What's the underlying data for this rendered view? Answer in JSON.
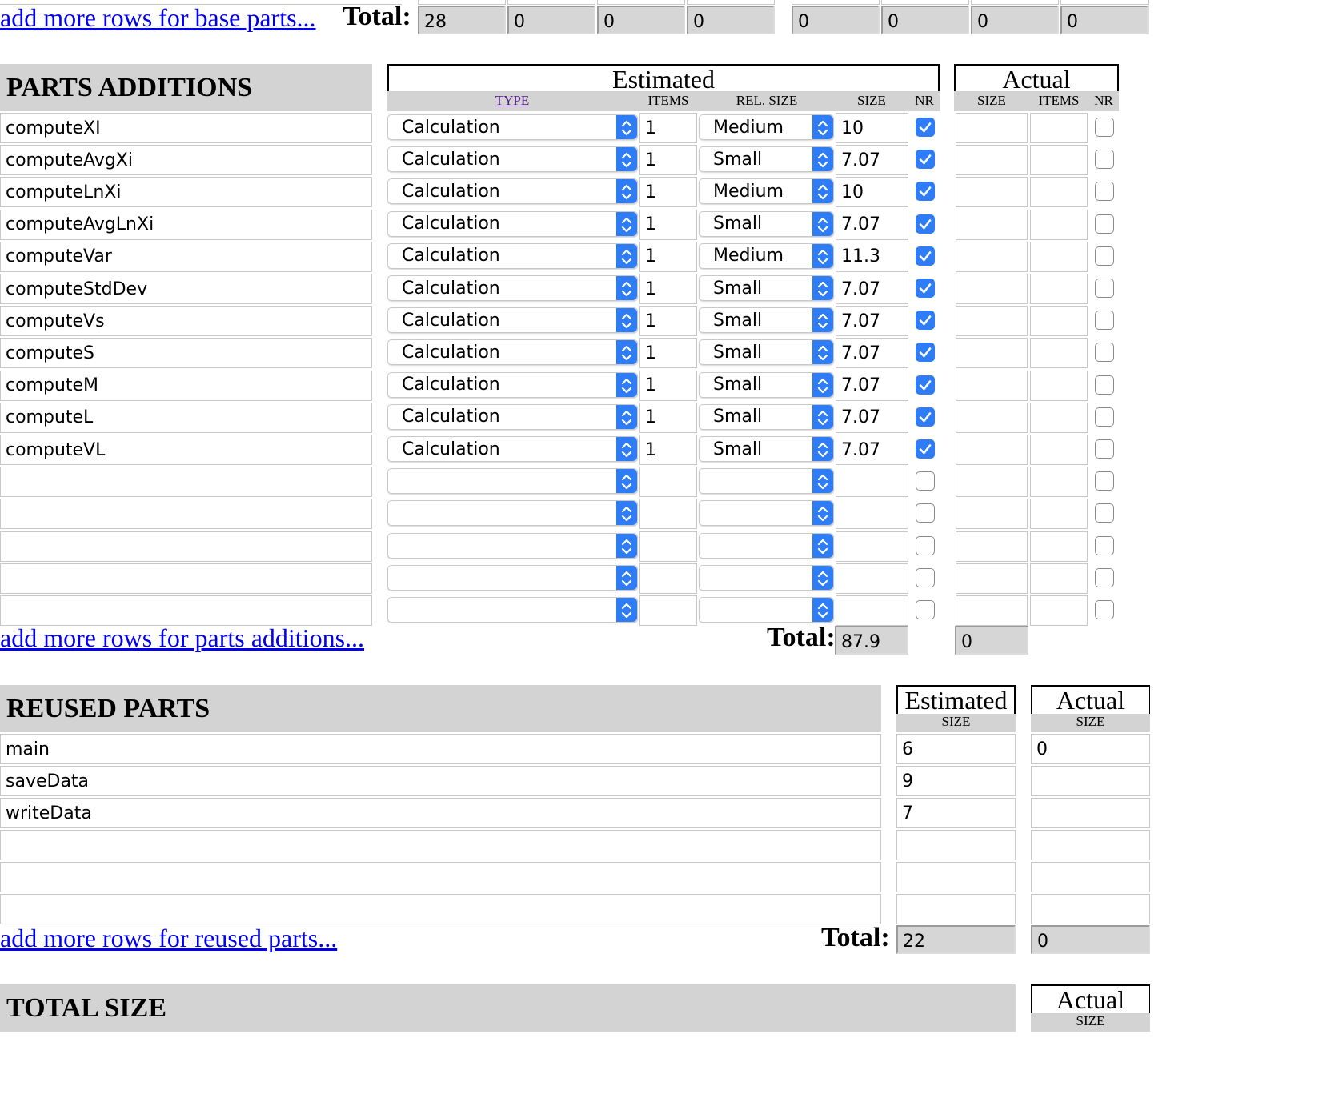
{
  "base_parts": {
    "add_more_link": "add more rows for base parts...",
    "total_label": "Total:",
    "estimated_totals": [
      "28",
      "0",
      "0",
      "0"
    ],
    "actual_totals": [
      "0",
      "0",
      "0",
      "0"
    ]
  },
  "parts_additions": {
    "title": "PARTS ADDITIONS",
    "estimated_header": "Estimated",
    "actual_header": "Actual",
    "columns": {
      "type": "TYPE",
      "items": "ITEMS",
      "rel_size": "REL. SIZE",
      "size": "SIZE",
      "nr": "NR",
      "actual_size": "SIZE",
      "actual_items": "ITEMS",
      "actual_nr": "NR"
    },
    "rows": [
      {
        "name": "computeXI",
        "type": "Calculation",
        "items": "1",
        "rel_size": "Medium",
        "size": "10",
        "nr": true,
        "actual_size": "",
        "actual_items": "",
        "actual_nr": false
      },
      {
        "name": "computeAvgXi",
        "type": "Calculation",
        "items": "1",
        "rel_size": "Small",
        "size": "7.07",
        "nr": true,
        "actual_size": "",
        "actual_items": "",
        "actual_nr": false
      },
      {
        "name": "computeLnXi",
        "type": "Calculation",
        "items": "1",
        "rel_size": "Medium",
        "size": "10",
        "nr": true,
        "actual_size": "",
        "actual_items": "",
        "actual_nr": false
      },
      {
        "name": "computeAvgLnXi",
        "type": "Calculation",
        "items": "1",
        "rel_size": "Small",
        "size": "7.07",
        "nr": true,
        "actual_size": "",
        "actual_items": "",
        "actual_nr": false
      },
      {
        "name": "computeVar",
        "type": "Calculation",
        "items": "1",
        "rel_size": "Medium",
        "size": "11.3",
        "nr": true,
        "actual_size": "",
        "actual_items": "",
        "actual_nr": false
      },
      {
        "name": "computeStdDev",
        "type": "Calculation",
        "items": "1",
        "rel_size": "Small",
        "size": "7.07",
        "nr": true,
        "actual_size": "",
        "actual_items": "",
        "actual_nr": false
      },
      {
        "name": "computeVs",
        "type": "Calculation",
        "items": "1",
        "rel_size": "Small",
        "size": "7.07",
        "nr": true,
        "actual_size": "",
        "actual_items": "",
        "actual_nr": false
      },
      {
        "name": "computeS",
        "type": "Calculation",
        "items": "1",
        "rel_size": "Small",
        "size": "7.07",
        "nr": true,
        "actual_size": "",
        "actual_items": "",
        "actual_nr": false
      },
      {
        "name": "computeM",
        "type": "Calculation",
        "items": "1",
        "rel_size": "Small",
        "size": "7.07",
        "nr": true,
        "actual_size": "",
        "actual_items": "",
        "actual_nr": false
      },
      {
        "name": "computeL",
        "type": "Calculation",
        "items": "1",
        "rel_size": "Small",
        "size": "7.07",
        "nr": true,
        "actual_size": "",
        "actual_items": "",
        "actual_nr": false
      },
      {
        "name": "computeVL",
        "type": "Calculation",
        "items": "1",
        "rel_size": "Small",
        "size": "7.07",
        "nr": true,
        "actual_size": "",
        "actual_items": "",
        "actual_nr": false
      },
      {
        "name": "",
        "type": "",
        "items": "",
        "rel_size": "",
        "size": "",
        "nr": false,
        "actual_size": "",
        "actual_items": "",
        "actual_nr": false
      },
      {
        "name": "",
        "type": "",
        "items": "",
        "rel_size": "",
        "size": "",
        "nr": false,
        "actual_size": "",
        "actual_items": "",
        "actual_nr": false
      },
      {
        "name": "",
        "type": "",
        "items": "",
        "rel_size": "",
        "size": "",
        "nr": false,
        "actual_size": "",
        "actual_items": "",
        "actual_nr": false
      },
      {
        "name": "",
        "type": "",
        "items": "",
        "rel_size": "",
        "size": "",
        "nr": false,
        "actual_size": "",
        "actual_items": "",
        "actual_nr": false
      },
      {
        "name": "",
        "type": "",
        "items": "",
        "rel_size": "",
        "size": "",
        "nr": false,
        "actual_size": "",
        "actual_items": "",
        "actual_nr": false
      }
    ],
    "add_more_link": "add more rows for parts additions...",
    "total_label": "Total:",
    "estimated_total": "87.9",
    "actual_total": "0"
  },
  "reused_parts": {
    "title": "REUSED PARTS",
    "estimated_header": "Estimated",
    "actual_header": "Actual",
    "size_label": "SIZE",
    "rows": [
      {
        "name": "main",
        "estimated": "6",
        "actual": "0"
      },
      {
        "name": "saveData",
        "estimated": "9",
        "actual": ""
      },
      {
        "name": "writeData",
        "estimated": "7",
        "actual": ""
      },
      {
        "name": "",
        "estimated": "",
        "actual": ""
      },
      {
        "name": "",
        "estimated": "",
        "actual": ""
      },
      {
        "name": "",
        "estimated": "",
        "actual": ""
      }
    ],
    "add_more_link": "add more rows for reused parts...",
    "total_label": "Total:",
    "estimated_total": "22",
    "actual_total": "0"
  },
  "total_size": {
    "title": "TOTAL SIZE",
    "actual_header": "Actual",
    "size_label": "SIZE"
  },
  "colors": {
    "link": "#0000ee",
    "header_bg": "#d3d3d3",
    "accent_blue": "#2f7df6"
  }
}
